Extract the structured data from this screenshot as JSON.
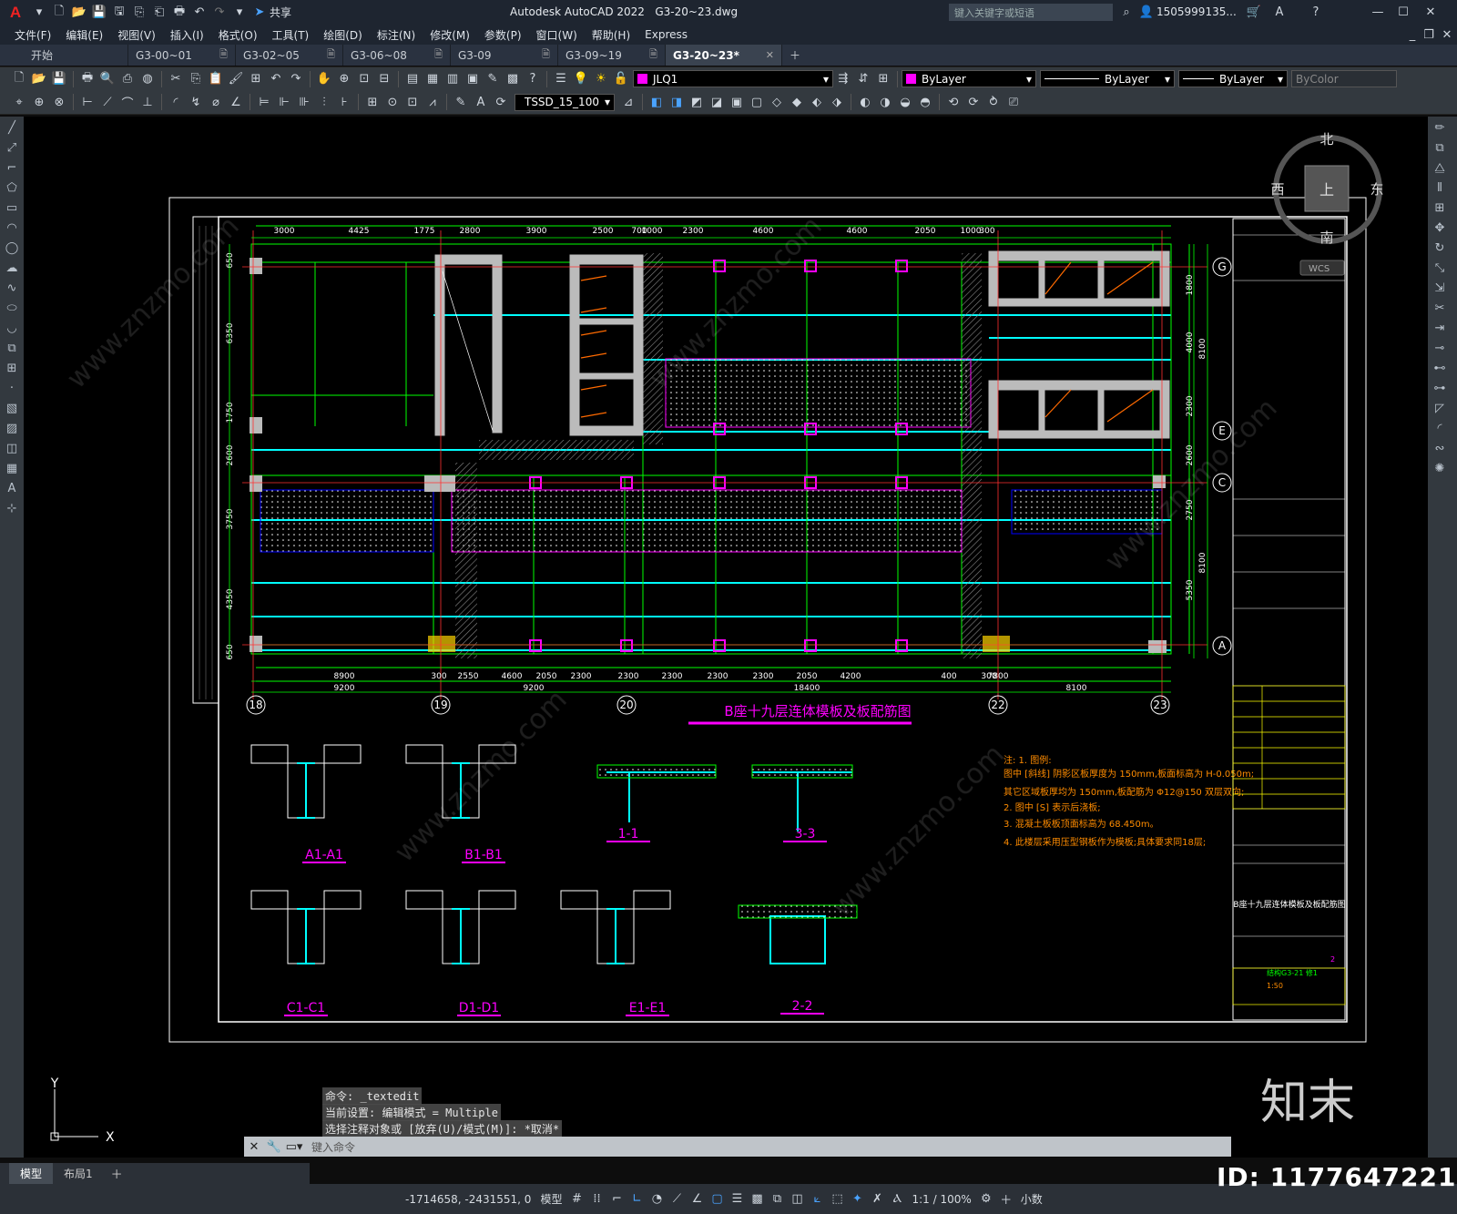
{
  "app": {
    "title": "Autodesk AutoCAD 2022",
    "file": "G3-20~23.dwg",
    "search_placeholder": "键入关键字或短语",
    "user": "1505999135...",
    "share": "共享"
  },
  "menu": [
    "文件(F)",
    "编辑(E)",
    "视图(V)",
    "插入(I)",
    "格式(O)",
    "工具(T)",
    "绘图(D)",
    "标注(N)",
    "修改(M)",
    "参数(P)",
    "窗口(W)",
    "帮助(H)",
    "Express"
  ],
  "tabs": [
    {
      "label": "开始",
      "active": false
    },
    {
      "label": "G3-00~01",
      "active": false
    },
    {
      "label": "G3-02~05",
      "active": false
    },
    {
      "label": "G3-06~08",
      "active": false
    },
    {
      "label": "G3-09",
      "active": false
    },
    {
      "label": "G3-09~19",
      "active": false
    },
    {
      "label": "G3-20~23*",
      "active": true
    }
  ],
  "toolbar": {
    "layer": "JLQ1",
    "color": "ByLayer",
    "linetype": "ByLayer",
    "lineweight": "ByLayer",
    "plotstyle": "ByColor",
    "dimstyle": "TSSD_15_100"
  },
  "viewcube": {
    "north": "北",
    "south": "南",
    "east": "东",
    "west": "西",
    "top": "上",
    "wcs": "WCS"
  },
  "drawing": {
    "title": "B座十九层连体模板及板配筋图",
    "top_dims": [
      "3000",
      "4425",
      "1775",
      "2800",
      "3900",
      "2500",
      "700",
      "1000",
      "2300",
      "4600",
      "4600",
      "2050",
      "1000",
      "300"
    ],
    "bottom_dims_1": [
      "8900",
      "300",
      "2550",
      "4600",
      "2050",
      "2300",
      "2300",
      "2300",
      "2300",
      "2300",
      "2050",
      "4200",
      "400",
      "300",
      "7800"
    ],
    "bottom_dims_2": [
      "9200",
      "9200",
      "18400",
      "8100"
    ],
    "grid_cols": [
      "18",
      "19",
      "20",
      "22",
      "23"
    ],
    "grid_rows": [
      "G",
      "E",
      "C",
      "A"
    ],
    "left_dims": [
      "650",
      "6350",
      "1750",
      "2600",
      "3750",
      "4350",
      "650"
    ],
    "right_dims": [
      "1800",
      "4000",
      "8100",
      "2300",
      "2600",
      "2750",
      "8100",
      "5350"
    ],
    "sections": [
      "A1-A1",
      "B1-B1",
      "1-1",
      "3-3",
      "C1-C1",
      "D1-D1",
      "E1-E1",
      "2-2"
    ],
    "notes": [
      "注: 1. 图例:",
      "图中 [斜线] 阴影区板厚度为 150mm,板面标高为 H-0.050m;",
      "其它区域板厚均为 150mm,板配筋为 Φ12@150  双层双向;",
      "2. 图中 [S] 表示后浇板;",
      "3. 混凝土板板顶面标高为 68.450m。",
      "4. 此楼层采用压型钢板作为模板;具体要求同18层;"
    ],
    "title_block": {
      "name": "B座十九层连体模板及板配筋图",
      "scale": "1:50",
      "sheet": "结构G3-21 修1",
      "rev": "2"
    }
  },
  "watermark": {
    "site": "www.znzmo.com",
    "brand": "知末",
    "id": "ID: 1177647221"
  },
  "command": {
    "line1": "命令: _textedit",
    "line2": "当前设置: 编辑模式 = Multiple",
    "line3": "选择注释对象或 [放弃(U)/模式(M)]: *取消*",
    "placeholder": "键入命令"
  },
  "status": {
    "model_tab": "模型",
    "layout_tab": "布局1",
    "coords": "-1714658, -2431551, 0",
    "space": "模型",
    "scale": "1:1 / 100%",
    "units": "小数"
  },
  "colors": {
    "accent": "#e22222",
    "bg": "#000000",
    "green": "#00ff00",
    "cyan": "#00ffff",
    "magenta": "#ff00ff",
    "orange": "#ff8c00",
    "yellow": "#ffff00"
  }
}
